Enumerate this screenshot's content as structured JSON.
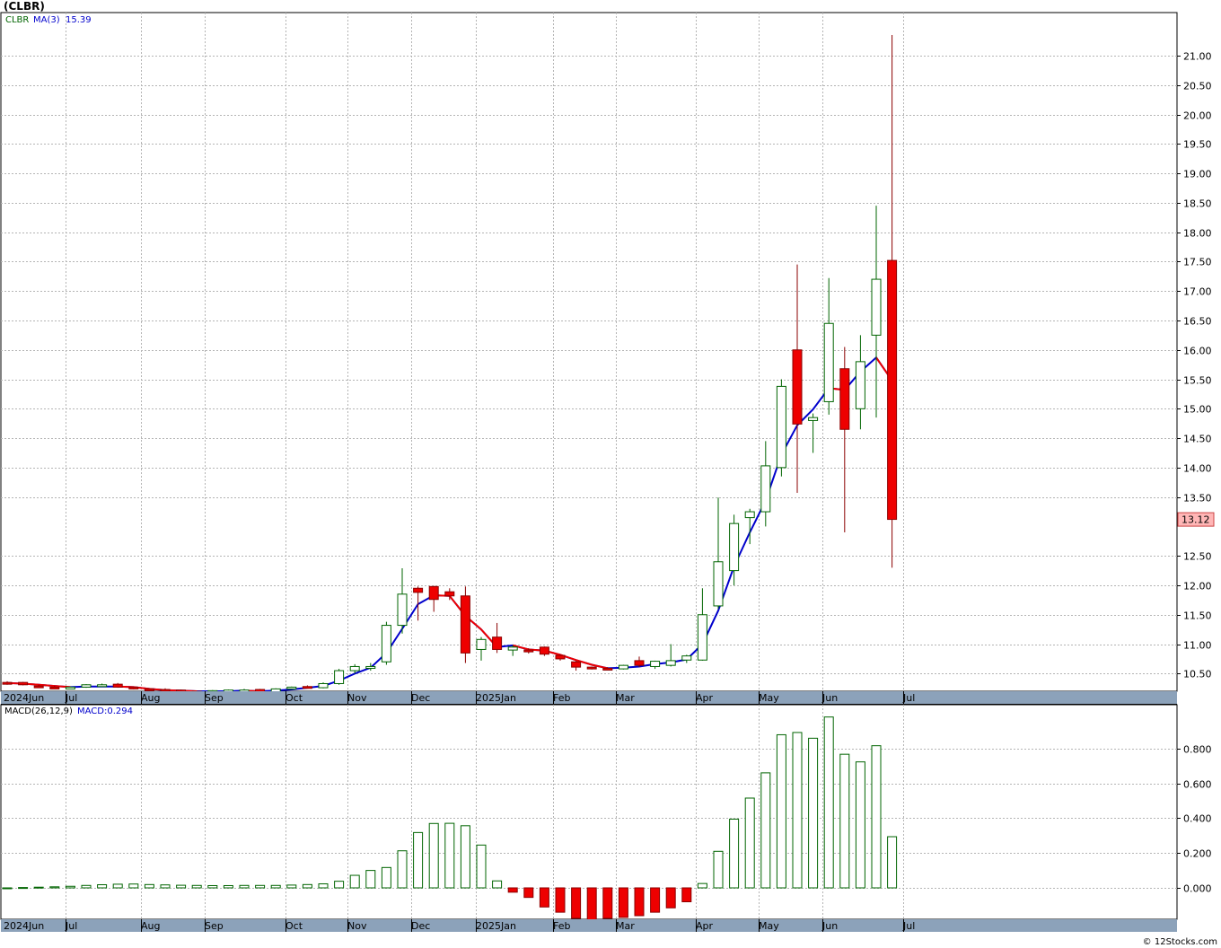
{
  "title": "(CLBR)",
  "footer": "© 12Stocks.com",
  "colors": {
    "up_body": "#ffffff",
    "up_line": "#006400",
    "down_body": "#ee0000",
    "down_line": "#8b0000",
    "ma_rising": "#0000cc",
    "ma_falling": "#ee0000",
    "grid": "#b4b4b4",
    "band": "#8ca2ba",
    "price_flag": "#ffb6b6"
  },
  "chart_data": [
    {
      "type": "candlestick",
      "frequency": "weekly",
      "legend": {
        "symbol": "CLBR",
        "ma_label": "MA(3)",
        "ma_value": "15.39"
      },
      "last_price": {
        "value": 13.12,
        "label": "13.12"
      },
      "y_axis": {
        "side": "right",
        "ylim": [
          10.2,
          21.35
        ],
        "ticks": [
          "10.50",
          "11.00",
          "11.50",
          "12.00",
          "12.50",
          "13.50",
          "14.00",
          "14.50",
          "15.00",
          "15.50",
          "16.00",
          "16.50",
          "17.00",
          "17.50",
          "18.00",
          "18.50",
          "19.00",
          "19.50",
          "20.00",
          "20.50",
          "21.00"
        ]
      },
      "x_axis": {
        "months": [
          "2024Jun",
          "Jul",
          "Aug",
          "Sep",
          "Oct",
          "Nov",
          "Dec",
          "2025Jan",
          "Feb",
          "Mar",
          "Apr",
          "May",
          "Jun",
          "Jul"
        ]
      },
      "grid": true,
      "candles": [
        {
          "o": 10.35,
          "h": 10.37,
          "l": 10.31,
          "c": 10.34
        },
        {
          "o": 10.35,
          "h": 10.36,
          "l": 10.3,
          "c": 10.31
        },
        {
          "o": 10.29,
          "h": 10.31,
          "l": 10.27,
          "c": 10.28
        },
        {
          "o": 10.27,
          "h": 10.29,
          "l": 10.25,
          "c": 10.26
        },
        {
          "o": 10.26,
          "h": 10.28,
          "l": 10.24,
          "c": 10.27
        },
        {
          "o": 10.27,
          "h": 10.32,
          "l": 10.26,
          "c": 10.31
        },
        {
          "o": 10.3,
          "h": 10.33,
          "l": 10.28,
          "c": 10.31
        },
        {
          "o": 10.32,
          "h": 10.34,
          "l": 10.26,
          "c": 10.27
        },
        {
          "o": 10.27,
          "h": 10.28,
          "l": 10.23,
          "c": 10.24
        },
        {
          "o": 10.24,
          "h": 10.25,
          "l": 10.21,
          "c": 10.22
        },
        {
          "o": 10.23,
          "h": 10.25,
          "l": 10.21,
          "c": 10.22
        },
        {
          "o": 10.22,
          "h": 10.23,
          "l": 10.2,
          "c": 10.21
        },
        {
          "o": 10.2,
          "h": 10.21,
          "l": 10.18,
          "c": 10.19
        },
        {
          "o": 10.19,
          "h": 10.22,
          "l": 10.18,
          "c": 10.21
        },
        {
          "o": 10.2,
          "h": 10.23,
          "l": 10.19,
          "c": 10.22
        },
        {
          "o": 10.21,
          "h": 10.24,
          "l": 10.2,
          "c": 10.22
        },
        {
          "o": 10.23,
          "h": 10.24,
          "l": 10.17,
          "c": 10.18
        },
        {
          "o": 10.18,
          "h": 10.25,
          "l": 10.17,
          "c": 10.24
        },
        {
          "o": 10.24,
          "h": 10.28,
          "l": 10.23,
          "c": 10.27
        },
        {
          "o": 10.28,
          "h": 10.3,
          "l": 10.25,
          "c": 10.26
        },
        {
          "o": 10.26,
          "h": 10.35,
          "l": 10.25,
          "c": 10.33
        },
        {
          "o": 10.33,
          "h": 10.58,
          "l": 10.31,
          "c": 10.55
        },
        {
          "o": 10.55,
          "h": 10.66,
          "l": 10.5,
          "c": 10.62
        },
        {
          "o": 10.6,
          "h": 10.68,
          "l": 10.55,
          "c": 10.62
        },
        {
          "o": 10.7,
          "h": 11.38,
          "l": 10.65,
          "c": 11.32
        },
        {
          "o": 11.32,
          "h": 12.29,
          "l": 11.18,
          "c": 11.85
        },
        {
          "o": 11.95,
          "h": 11.98,
          "l": 11.4,
          "c": 11.88
        },
        {
          "o": 11.98,
          "h": 11.99,
          "l": 11.55,
          "c": 11.76
        },
        {
          "o": 11.89,
          "h": 11.95,
          "l": 11.75,
          "c": 11.82
        },
        {
          "o": 11.82,
          "h": 11.98,
          "l": 10.68,
          "c": 10.85
        },
        {
          "o": 10.91,
          "h": 11.12,
          "l": 10.72,
          "c": 11.08
        },
        {
          "o": 11.12,
          "h": 11.36,
          "l": 10.85,
          "c": 10.91
        },
        {
          "o": 10.9,
          "h": 10.98,
          "l": 10.8,
          "c": 10.95
        },
        {
          "o": 10.9,
          "h": 10.93,
          "l": 10.84,
          "c": 10.88
        },
        {
          "o": 10.95,
          "h": 10.96,
          "l": 10.8,
          "c": 10.83
        },
        {
          "o": 10.81,
          "h": 10.83,
          "l": 10.72,
          "c": 10.75
        },
        {
          "o": 10.7,
          "h": 10.72,
          "l": 10.55,
          "c": 10.61
        },
        {
          "o": 10.61,
          "h": 10.62,
          "l": 10.57,
          "c": 10.59
        },
        {
          "o": 10.59,
          "h": 10.61,
          "l": 10.56,
          "c": 10.57
        },
        {
          "o": 10.58,
          "h": 10.65,
          "l": 10.57,
          "c": 10.64
        },
        {
          "o": 10.72,
          "h": 10.79,
          "l": 10.61,
          "c": 10.64
        },
        {
          "o": 10.62,
          "h": 10.72,
          "l": 10.58,
          "c": 10.71
        },
        {
          "o": 10.64,
          "h": 11.0,
          "l": 10.62,
          "c": 10.72
        },
        {
          "o": 10.73,
          "h": 10.82,
          "l": 10.68,
          "c": 10.8
        },
        {
          "o": 10.73,
          "h": 11.95,
          "l": 10.72,
          "c": 11.5
        },
        {
          "o": 11.65,
          "h": 13.49,
          "l": 11.6,
          "c": 12.4
        },
        {
          "o": 12.25,
          "h": 13.2,
          "l": 12.0,
          "c": 13.05
        },
        {
          "o": 13.15,
          "h": 13.3,
          "l": 12.7,
          "c": 13.25
        },
        {
          "o": 13.25,
          "h": 14.45,
          "l": 13.0,
          "c": 14.03
        },
        {
          "o": 14.0,
          "h": 15.5,
          "l": 13.85,
          "c": 15.38
        },
        {
          "o": 16.0,
          "h": 17.45,
          "l": 13.57,
          "c": 14.74
        },
        {
          "o": 14.8,
          "h": 14.92,
          "l": 14.25,
          "c": 14.85
        },
        {
          "o": 15.12,
          "h": 17.22,
          "l": 14.9,
          "c": 16.45
        },
        {
          "o": 15.68,
          "h": 16.05,
          "l": 12.9,
          "c": 14.65
        },
        {
          "o": 15.0,
          "h": 16.25,
          "l": 14.65,
          "c": 15.8
        },
        {
          "o": 16.25,
          "h": 18.45,
          "l": 14.85,
          "c": 17.2
        },
        {
          "o": 17.52,
          "h": 21.35,
          "l": 12.3,
          "c": 13.12
        }
      ],
      "moving_average": [
        10.34,
        10.33,
        10.31,
        10.29,
        10.27,
        10.28,
        10.28,
        10.28,
        10.27,
        10.24,
        10.22,
        10.21,
        10.2,
        10.2,
        10.2,
        10.21,
        10.2,
        10.21,
        10.23,
        10.26,
        10.29,
        10.38,
        10.5,
        10.6,
        10.85,
        11.26,
        11.68,
        11.83,
        11.82,
        11.48,
        11.25,
        10.95,
        10.98,
        10.91,
        10.89,
        10.82,
        10.73,
        10.65,
        10.59,
        10.6,
        10.62,
        10.66,
        10.69,
        10.74,
        11.0,
        11.57,
        12.32,
        12.9,
        13.44,
        14.22,
        14.72,
        14.99,
        15.35,
        15.32,
        15.63,
        15.87,
        15.48
      ]
    },
    {
      "type": "bar",
      "name": "MACD",
      "legend": {
        "params": "MACD(26,12,9)",
        "value_label": "MACD:0.294"
      },
      "y_axis": {
        "side": "right",
        "ylim": [
          -0.19,
          0.99
        ],
        "ticks": [
          "0.000",
          "0.200",
          "0.400",
          "0.600",
          "0.800"
        ]
      },
      "x_axis": {
        "months": [
          "2024Jun",
          "Jul",
          "Aug",
          "Sep",
          "Oct",
          "Nov",
          "Dec",
          "2025Jan",
          "Feb",
          "Mar",
          "Apr",
          "May",
          "Jun",
          "Jul"
        ]
      },
      "grid": true,
      "values": [
        0.0,
        0.002,
        0.004,
        0.006,
        0.009,
        0.014,
        0.018,
        0.021,
        0.022,
        0.019,
        0.017,
        0.015,
        0.014,
        0.013,
        0.013,
        0.014,
        0.014,
        0.014,
        0.016,
        0.019,
        0.023,
        0.038,
        0.072,
        0.1,
        0.117,
        0.213,
        0.318,
        0.37,
        0.371,
        0.357,
        0.246,
        0.04,
        -0.025,
        -0.055,
        -0.11,
        -0.14,
        -0.175,
        -0.185,
        -0.175,
        -0.17,
        -0.16,
        -0.14,
        -0.115,
        -0.08,
        0.025,
        0.21,
        0.395,
        0.516,
        0.661,
        0.88,
        0.893,
        0.86,
        0.982,
        0.768,
        0.724,
        0.817,
        0.294
      ]
    }
  ]
}
